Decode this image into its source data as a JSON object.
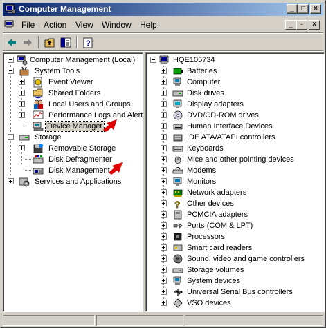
{
  "window": {
    "title": "Computer Management"
  },
  "menu": {
    "file": "File",
    "action": "Action",
    "view": "View",
    "window": "Window",
    "help": "Help"
  },
  "left_tree": {
    "root": "Computer Management (Local)",
    "system_tools": "System Tools",
    "event_viewer": "Event Viewer",
    "shared_folders": "Shared Folders",
    "local_users": "Local Users and Groups",
    "perf_logs": "Performance Logs and Alerts",
    "device_manager": "Device Manager",
    "storage": "Storage",
    "removable_storage": "Removable Storage",
    "disk_defrag": "Disk Defragmenter",
    "disk_management": "Disk Management",
    "services_apps": "Services and Applications"
  },
  "right_tree": {
    "root": "HQE105734",
    "items": [
      {
        "label": "Batteries",
        "icon": "battery-icon"
      },
      {
        "label": "Computer",
        "icon": "computer-icon"
      },
      {
        "label": "Disk drives",
        "icon": "disk-drive-icon"
      },
      {
        "label": "Display adapters",
        "icon": "display-adapter-icon"
      },
      {
        "label": "DVD/CD-ROM drives",
        "icon": "cdrom-icon"
      },
      {
        "label": "Human Interface Devices",
        "icon": "hid-icon"
      },
      {
        "label": "IDE ATA/ATAPI controllers",
        "icon": "ide-controller-icon"
      },
      {
        "label": "Keyboards",
        "icon": "keyboard-icon"
      },
      {
        "label": "Mice and other pointing devices",
        "icon": "mouse-icon"
      },
      {
        "label": "Modems",
        "icon": "modem-icon"
      },
      {
        "label": "Monitors",
        "icon": "monitor-icon"
      },
      {
        "label": "Network adapters",
        "icon": "network-adapter-icon"
      },
      {
        "label": "Other devices",
        "icon": "unknown-device-icon"
      },
      {
        "label": "PCMCIA adapters",
        "icon": "pcmcia-icon"
      },
      {
        "label": "Ports (COM & LPT)",
        "icon": "port-icon"
      },
      {
        "label": "Processors",
        "icon": "processor-icon"
      },
      {
        "label": "Smart card readers",
        "icon": "smart-card-icon"
      },
      {
        "label": "Sound, video and game controllers",
        "icon": "sound-icon"
      },
      {
        "label": "Storage volumes",
        "icon": "storage-volume-icon"
      },
      {
        "label": "System devices",
        "icon": "system-device-icon"
      },
      {
        "label": "Universal Serial Bus controllers",
        "icon": "usb-icon"
      },
      {
        "label": "VSO devices",
        "icon": "vso-device-icon"
      }
    ]
  },
  "colors": {
    "title_gradient_start": "#0a246a",
    "title_gradient_end": "#a6caf0",
    "chrome": "#d4d0c8",
    "annotation_arrow": "#e00000"
  }
}
